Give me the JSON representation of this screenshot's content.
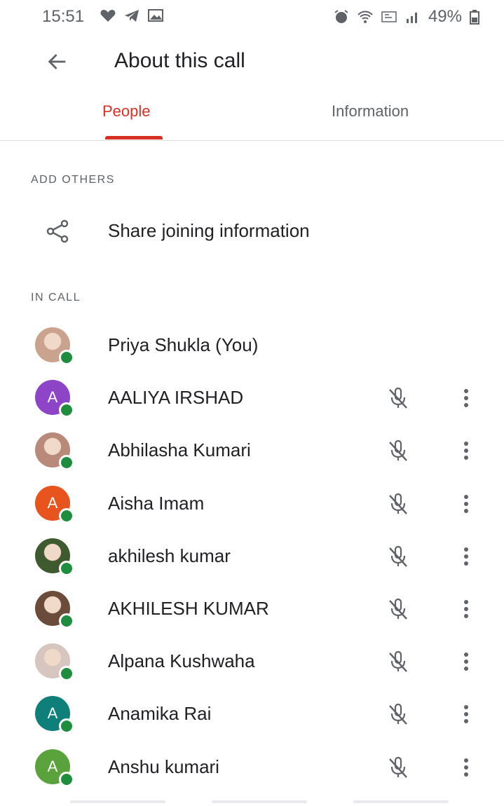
{
  "status_bar": {
    "time": "15:51",
    "battery": "49%",
    "left_icons": [
      "heart-icon",
      "telegram-icon",
      "gallery-icon"
    ],
    "right_icons": [
      "alarm-icon",
      "wifi-icon",
      "volte-icon",
      "signal-icon",
      "battery-icon"
    ]
  },
  "app_bar": {
    "title": "About this call"
  },
  "tabs": [
    {
      "label": "People",
      "active": true
    },
    {
      "label": "Information",
      "active": false
    }
  ],
  "sections": {
    "add_others": "ADD OTHERS",
    "in_call": "IN CALL"
  },
  "share": {
    "label": "Share joining information"
  },
  "participants": [
    {
      "name": "Priya Shukla (You)",
      "avatar": "photo",
      "photo_tone": "#c9a38e",
      "initial": "",
      "color": "",
      "muted_icon": false
    },
    {
      "name": "AALIYA IRSHAD",
      "avatar": "letter",
      "initial": "A",
      "color": "#8e44c7",
      "muted_icon": true
    },
    {
      "name": "Abhilasha Kumari",
      "avatar": "photo",
      "photo_tone": "#b98a7a",
      "initial": "",
      "color": "",
      "muted_icon": true
    },
    {
      "name": "Aisha Imam",
      "avatar": "letter",
      "initial": "A",
      "color": "#e8541e",
      "muted_icon": true
    },
    {
      "name": "akhilesh kumar",
      "avatar": "photo",
      "photo_tone": "#3f5a2e",
      "initial": "",
      "color": "",
      "muted_icon": true
    },
    {
      "name": "AKHILESH KUMAR",
      "avatar": "photo",
      "photo_tone": "#6b4b3a",
      "initial": "",
      "color": "",
      "muted_icon": true
    },
    {
      "name": "Alpana Kushwaha",
      "avatar": "photo",
      "photo_tone": "#d7c6c0",
      "initial": "",
      "color": "",
      "muted_icon": true
    },
    {
      "name": "Anamika Rai",
      "avatar": "letter",
      "initial": "A",
      "color": "#0f7f7a",
      "muted_icon": true
    },
    {
      "name": "Anshu kumari",
      "avatar": "letter",
      "initial": "A",
      "color": "#5aa23c",
      "muted_icon": true
    }
  ],
  "colors": {
    "accent": "#d93025",
    "presence": "#1e8e3e",
    "text_secondary": "#5f6368"
  }
}
